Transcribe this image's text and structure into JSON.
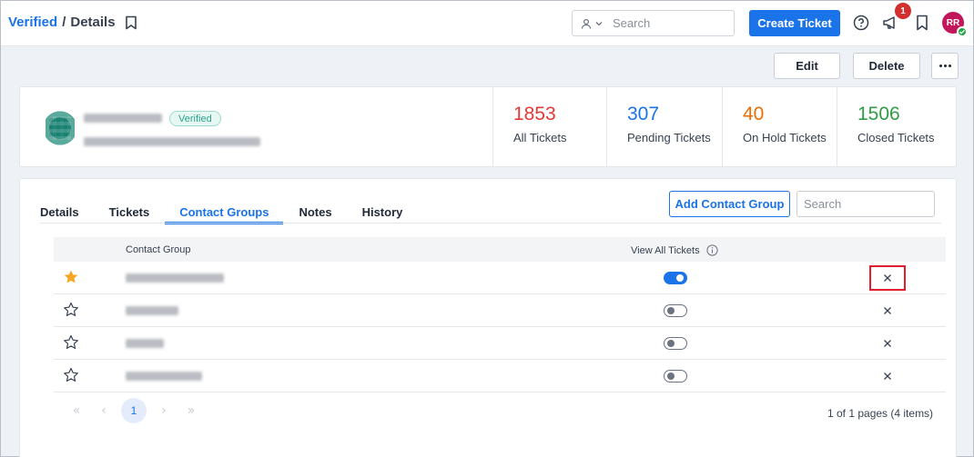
{
  "header": {
    "breadcrumb_link": "Verified",
    "breadcrumb_sep": "/",
    "breadcrumb_current": "Details",
    "search_placeholder": "Search",
    "create_ticket_label": "Create Ticket",
    "notification_count": "1",
    "avatar_initials": "RR"
  },
  "actions": {
    "edit_label": "Edit",
    "delete_label": "Delete"
  },
  "profile": {
    "status_badge": "Verified",
    "stats": [
      {
        "value": "1853",
        "label": "All Tickets",
        "color": "#e53935"
      },
      {
        "value": "307",
        "label": "Pending Tickets",
        "color": "#1a73e8"
      },
      {
        "value": "40",
        "label": "On Hold Tickets",
        "color": "#ef6c00"
      },
      {
        "value": "1506",
        "label": "Closed Tickets",
        "color": "#2e9d46"
      }
    ]
  },
  "tabs": [
    {
      "label": "Details",
      "active": false
    },
    {
      "label": "Tickets",
      "active": false
    },
    {
      "label": "Contact Groups",
      "active": true
    },
    {
      "label": "Notes",
      "active": false
    },
    {
      "label": "History",
      "active": false
    }
  ],
  "contact_groups": {
    "add_button_label": "Add Contact Group",
    "search_placeholder": "Search",
    "columns": {
      "group": "Contact Group",
      "view_all": "View All Tickets"
    },
    "rows": [
      {
        "starred": true,
        "view_all_tickets": true
      },
      {
        "starred": false,
        "view_all_tickets": false
      },
      {
        "starred": false,
        "view_all_tickets": false
      },
      {
        "starred": false,
        "view_all_tickets": false
      }
    ],
    "pagination": {
      "current_page": "1",
      "info": "1 of 1 pages (4 items)"
    }
  },
  "colors": {
    "accent": "#1a73e8",
    "star_filled": "#f5a623",
    "highlight_border": "#e11d2e"
  }
}
